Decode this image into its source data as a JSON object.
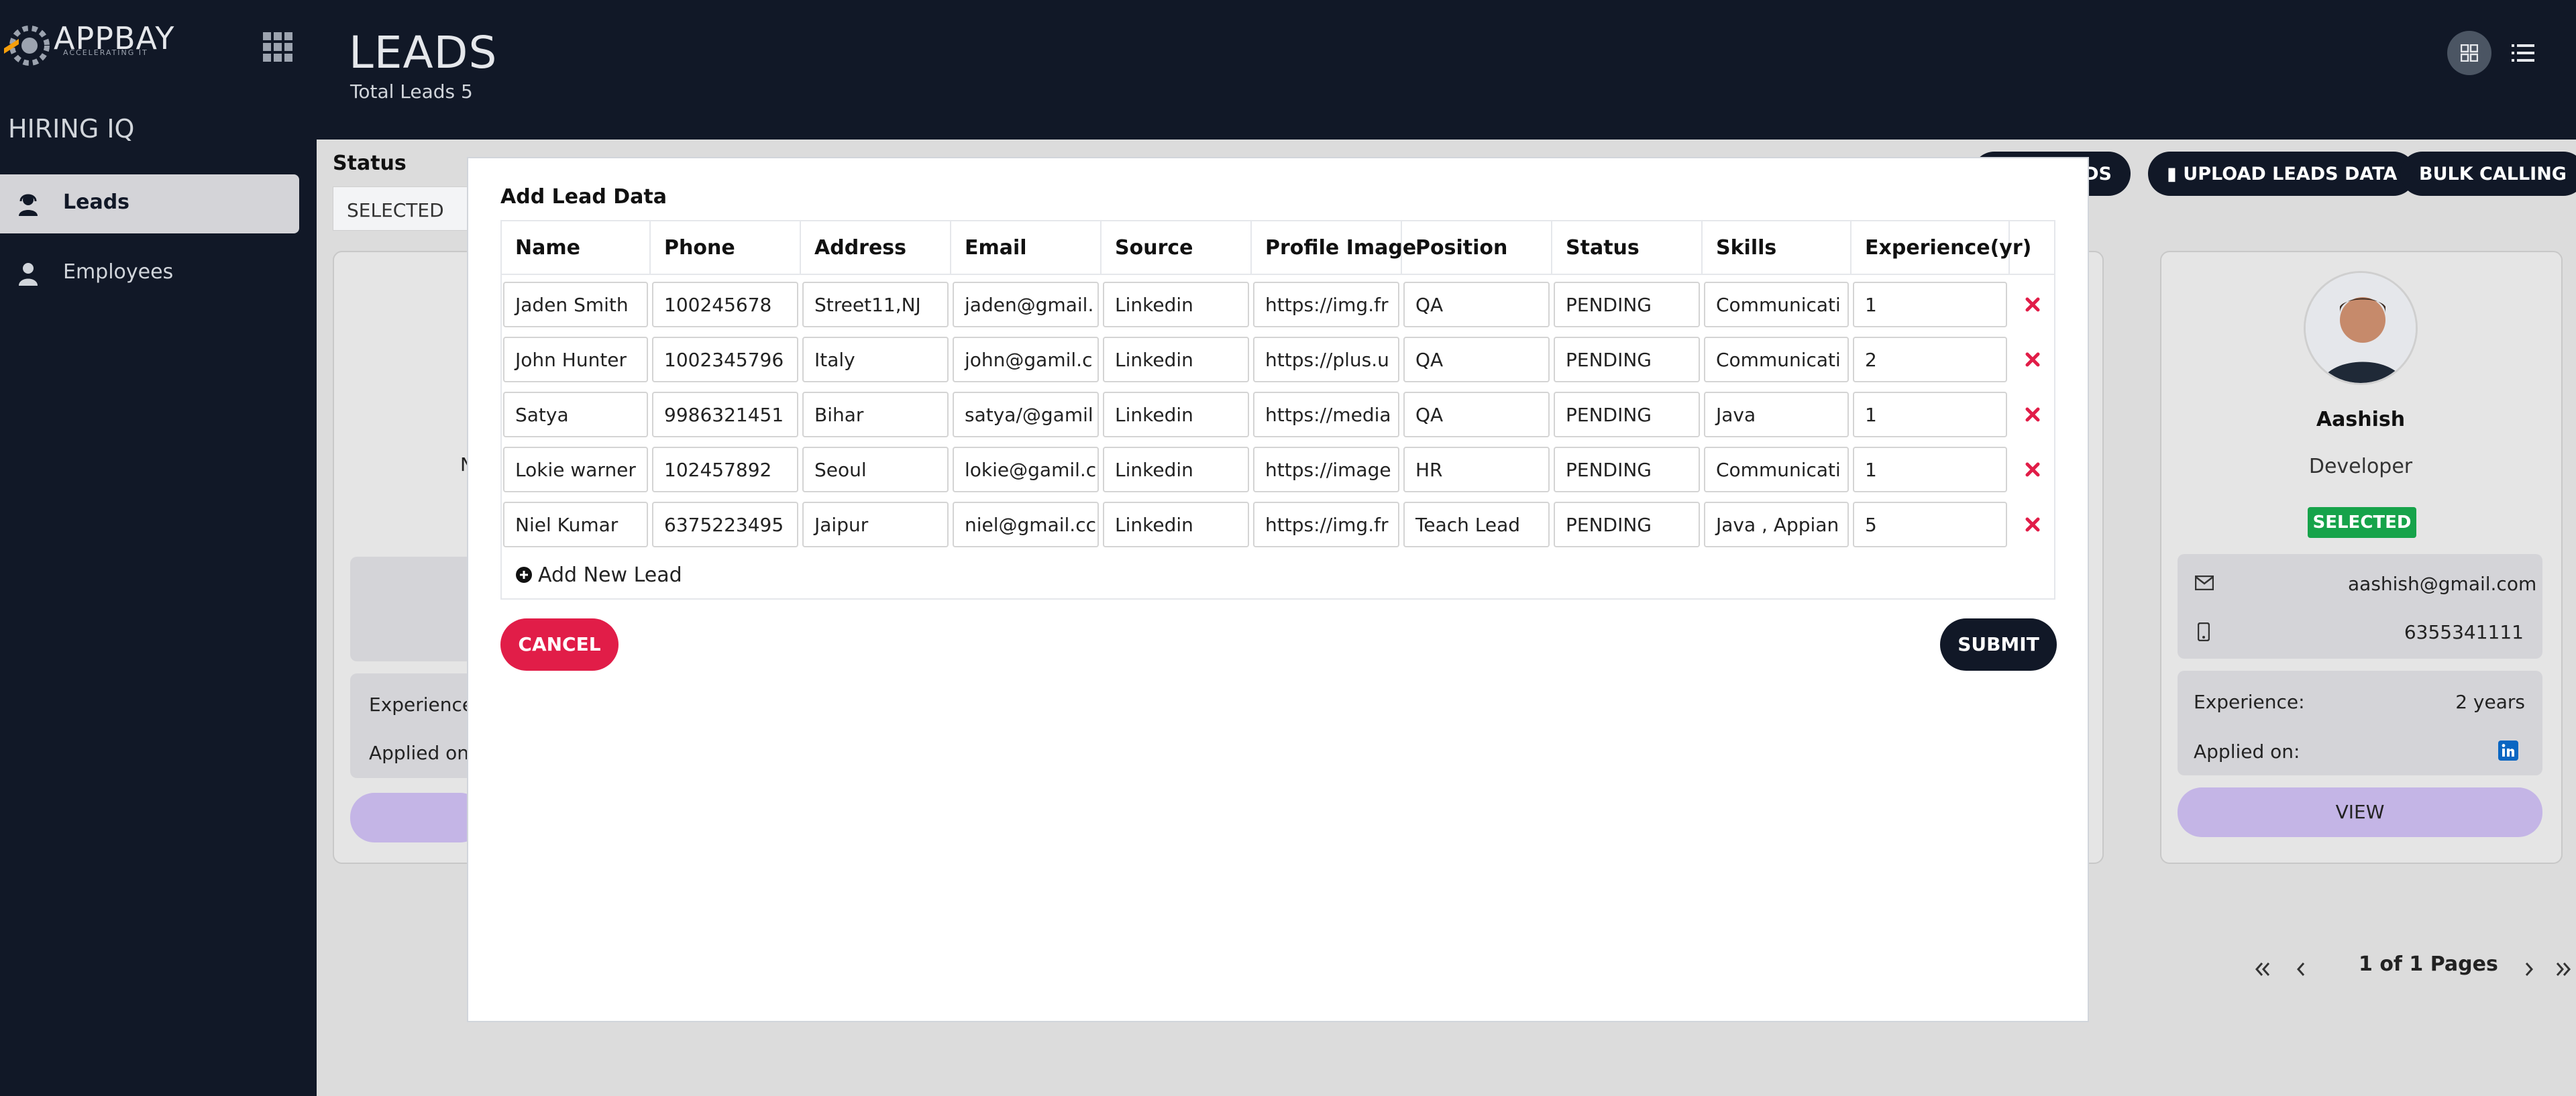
{
  "app": {
    "logo_text": "APPBAY",
    "logo_tagline": "ACCELERATING IT",
    "brand": "HIRING IQ"
  },
  "header": {
    "title": "LEADS",
    "subtitle": "Total Leads 5"
  },
  "sidebar": {
    "items": [
      {
        "label": "Leads",
        "icon": "user-headset-icon",
        "active": true
      },
      {
        "label": "Employees",
        "icon": "user-icon",
        "active": false
      }
    ]
  },
  "background": {
    "filter_label": "Status",
    "filter_value": "SELECTED",
    "buttons": [
      "DS",
      "UPLOAD LEADS DATA",
      "BULK CALLING"
    ],
    "card": {
      "name": "Aashish",
      "role": "Developer",
      "status": "SELECTED",
      "email": "aashish@gmail.com",
      "phone": "6355341111",
      "experience_label": "Experience:",
      "experience_value": "2 years",
      "applied_label": "Applied on:",
      "view_label": "VIEW"
    },
    "left_card": {
      "experience_label": "Experience",
      "applied_label": "Applied on:",
      "letter": "N"
    },
    "pager": "1 of 1 Pages"
  },
  "modal": {
    "title": "Add Lead Data",
    "columns": [
      "Name",
      "Phone",
      "Address",
      "Email",
      "Source",
      "Profile Image",
      "Position",
      "Status",
      "Skills",
      "Experience(yr)"
    ],
    "rows": [
      [
        "Jaden Smith",
        "100245678",
        "Street11,NJ",
        "jaden@gmail.",
        "Linkedin",
        "https://img.fr",
        "QA",
        "PENDING",
        "Communicati",
        "1"
      ],
      [
        "John Hunter",
        "1002345796",
        "Italy",
        "john@gamil.c",
        "Linkedin",
        "https://plus.u",
        "QA",
        "PENDING",
        "Communicati",
        "2"
      ],
      [
        "Satya",
        "9986321451",
        "Bihar",
        "satya/@gamil",
        "Linkedin",
        "https://media",
        "QA",
        "PENDING",
        "Java",
        "1"
      ],
      [
        "Lokie warner",
        "102457892",
        "Seoul",
        "lokie@gamil.c",
        "Linkedin",
        "https://image",
        "HR",
        "PENDING",
        "Communicati",
        "1"
      ],
      [
        "Niel Kumar",
        "6375223495",
        "Jaipur",
        "niel@gmail.cc",
        "Linkedin",
        "https://img.fr",
        "Teach Lead",
        "PENDING",
        "Java , Appian",
        "5"
      ]
    ],
    "add_new_label": "Add New Lead",
    "cancel_label": "CANCEL",
    "submit_label": "SUBMIT"
  },
  "colors": {
    "dark": "#111827",
    "danger": "#e11d48",
    "success": "#16a34a",
    "view_button": "#c4b5e6"
  }
}
